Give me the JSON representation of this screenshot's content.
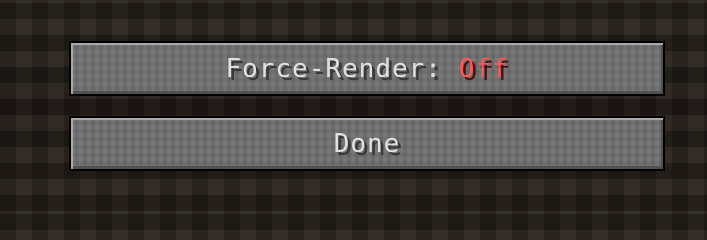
{
  "menu": {
    "force_render": {
      "label": "Force-Render: ",
      "value": "Off",
      "value_color": "#ff5555"
    },
    "done": {
      "label": "Done"
    }
  },
  "colors": {
    "button_face": "#6f6f6f",
    "button_text": "#e0e0e0",
    "background": "#2a231d"
  }
}
